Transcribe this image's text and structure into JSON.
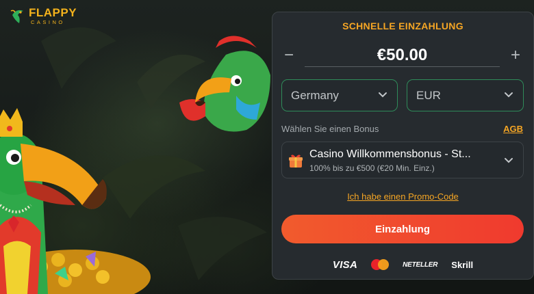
{
  "logo": {
    "title": "FLAPPY",
    "subtitle": "CASINO"
  },
  "panel": {
    "title": "SCHNELLE EINZAHLUNG",
    "amount": {
      "minus_label": "−",
      "value": "€50.00",
      "plus_label": "+"
    },
    "country_select": {
      "value": "Germany",
      "icon": "chevron-down-icon"
    },
    "currency_select": {
      "value": "EUR",
      "icon": "chevron-down-icon"
    },
    "bonus_label": "Wählen Sie einen Bonus",
    "agb_link": "AGB",
    "bonus": {
      "title": "Casino Willkommensbonus - St...",
      "subtitle": "100% bis zu €500 (€20 Min. Einz.)",
      "icon": "gift-icon"
    },
    "promo_link": "Ich habe einen Promo-Code",
    "deposit_button": "Einzahlung",
    "payment_methods": {
      "visa": "VISA",
      "mastercard": "mastercard-icon",
      "neteller": "NETELLER",
      "skrill": "Skrill"
    }
  },
  "colors": {
    "accent": "#f6a624",
    "deposit_button": "#f0452d",
    "select_border": "#2f8c5a",
    "panel_bg": "#262b2f"
  }
}
